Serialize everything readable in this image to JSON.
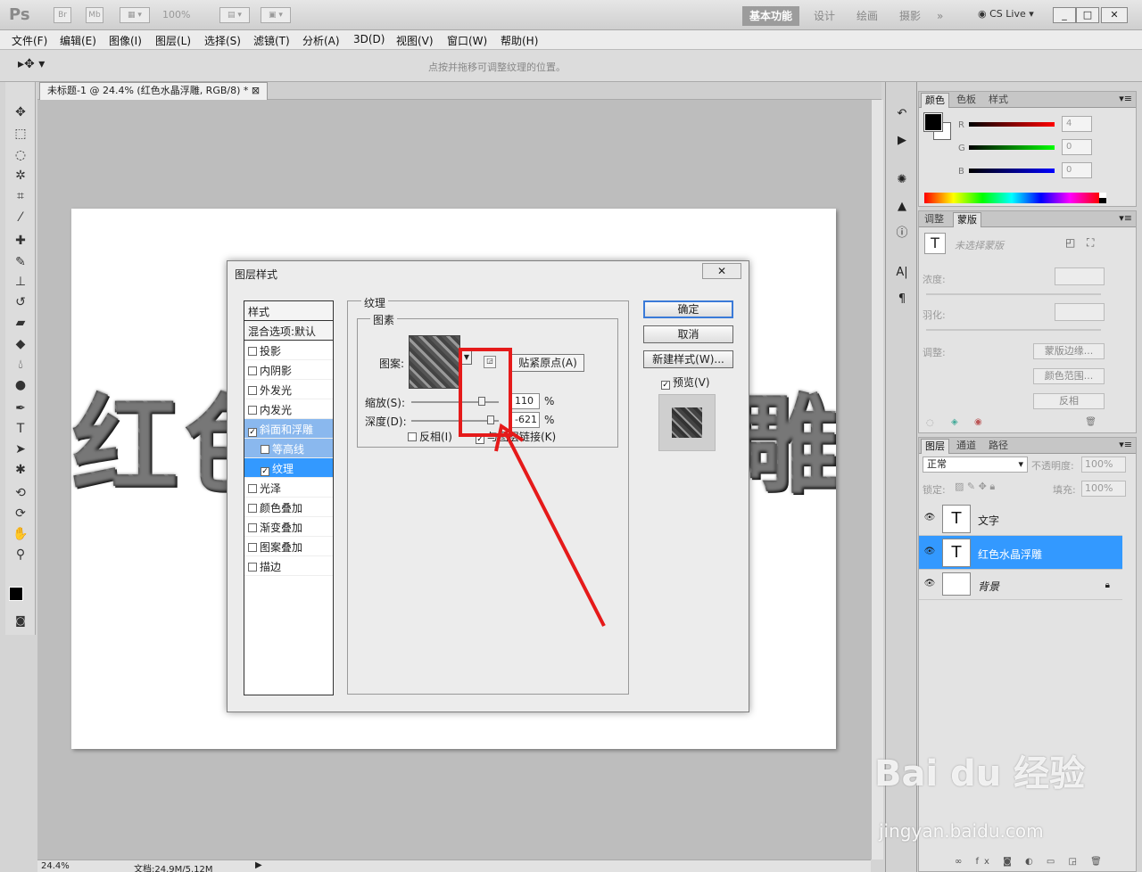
{
  "app": {
    "logo": "Ps",
    "bridge_btn": "Br",
    "minibridge_btn": "Mb",
    "zoom": "100%",
    "workspaces": [
      "基本功能",
      "设计",
      "绘画",
      "摄影"
    ],
    "cslive": "CS Live",
    "window_min": "_",
    "window_max": "□",
    "window_close": "✕"
  },
  "menu": [
    "文件(F)",
    "编辑(E)",
    "图像(I)",
    "图层(L)",
    "选择(S)",
    "滤镜(T)",
    "分析(A)",
    "3D(D)",
    "视图(V)",
    "窗口(W)",
    "帮助(H)"
  ],
  "options_bar": {
    "hint": "点按并拖移可调整纹理的位置。"
  },
  "document": {
    "tab_title": "未标题-1 @ 24.4% (红色水晶浮雕, RGB/8) *",
    "canvas_text_left": "红色",
    "canvas_text_right": "雕",
    "status_zoom": "24.4%",
    "status_doc": "文档:24.9M/5.12M"
  },
  "dialog": {
    "title": "图层样式",
    "close": "✕",
    "styles_header": "样式",
    "blend_options": "混合选项:默认",
    "style_items": [
      {
        "label": "投影",
        "checked": false
      },
      {
        "label": "内阴影",
        "checked": false
      },
      {
        "label": "外发光",
        "checked": false
      },
      {
        "label": "内发光",
        "checked": false
      },
      {
        "label": "斜面和浮雕",
        "checked": true
      },
      {
        "label": "等高线",
        "checked": false
      },
      {
        "label": "纹理",
        "checked": true
      },
      {
        "label": "光泽",
        "checked": false
      },
      {
        "label": "颜色叠加",
        "checked": false
      },
      {
        "label": "渐变叠加",
        "checked": false
      },
      {
        "label": "图案叠加",
        "checked": false
      },
      {
        "label": "描边",
        "checked": false
      }
    ],
    "section_title": "纹理",
    "subsection_title": "图素",
    "pattern_label": "图案:",
    "snap_origin": "贴紧原点(A)",
    "scale_label": "缩放(S):",
    "scale_value": "110",
    "depth_label": "深度(D):",
    "depth_value": "-621",
    "pct": "%",
    "invert_label": "反相(I)",
    "link_label": "与图层链接(K)",
    "link_checked": true,
    "ok": "确定",
    "cancel": "取消",
    "new_style": "新建样式(W)...",
    "preview": "预览(V)"
  },
  "panels": {
    "color_tabs": [
      "颜色",
      "色板",
      "样式"
    ],
    "rgb": [
      {
        "label": "R",
        "value": "4"
      },
      {
        "label": "G",
        "value": "0"
      },
      {
        "label": "B",
        "value": "0"
      }
    ],
    "adjust_tabs": [
      "调整",
      "蒙版"
    ],
    "mask_none": "未选择蒙版",
    "density": "浓度:",
    "feather": "羽化:",
    "refine": "调整:",
    "mask_edge": "蒙版边缘...",
    "color_range": "颜色范围...",
    "invert": "反相",
    "layers_tabs": [
      "图层",
      "通道",
      "路径"
    ],
    "blend_mode": "正常",
    "opacity_label": "不透明度:",
    "opacity_value": "100%",
    "lock_label": "锁定:",
    "fill_label": "填充:",
    "fill_value": "100%",
    "layers": [
      {
        "name": "文字",
        "thumb": "T",
        "selected": false
      },
      {
        "name": "红色水晶浮雕",
        "thumb": "T",
        "selected": true
      },
      {
        "name": "背景",
        "thumb": "",
        "selected": false
      }
    ]
  },
  "watermark": {
    "brand": "Bai du 经验",
    "url": "jingyan.baidu.com"
  }
}
